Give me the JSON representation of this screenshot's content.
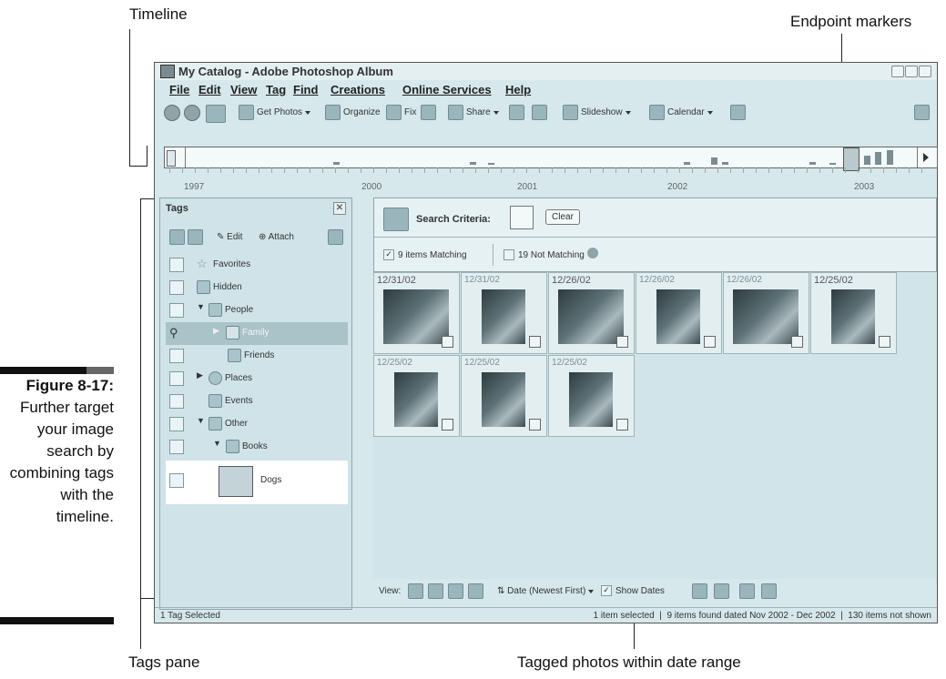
{
  "callouts": {
    "timeline": "Timeline",
    "endpoint_markers": "Endpoint markers",
    "tags_pane": "Tags pane",
    "tagged_photos": "Tagged photos within date range"
  },
  "caption": {
    "figure": "Figure 8-17:",
    "text": "Further target your image search by combining tags with the timeline."
  },
  "window": {
    "title": "My Catalog - Adobe Photoshop Album"
  },
  "menu": [
    "File",
    "Edit",
    "View",
    "Tag",
    "Find",
    "Creations",
    "Online Services",
    "Help"
  ],
  "toolbar": {
    "get_photos": "Get Photos",
    "organize": "Organize",
    "fix": "Fix",
    "share": "Share",
    "slideshow": "Slideshow",
    "calendar": "Calendar"
  },
  "timeline": {
    "years": [
      "1997",
      "2000",
      "2001",
      "2002",
      "2003"
    ]
  },
  "tags_pane": {
    "title": "Tags",
    "edit": "Edit",
    "attach": "Attach",
    "items": [
      "Favorites",
      "Hidden",
      "People",
      "Family",
      "Friends",
      "Places",
      "Events",
      "Other",
      "Books",
      "Dogs"
    ]
  },
  "search": {
    "criteria": "Search Criteria:",
    "clear": "Clear",
    "matching": "9 items Matching",
    "not_matching": "19 Not Matching"
  },
  "photos": {
    "dates": [
      "12/31/02",
      "12/31/02",
      "12/26/02",
      "12/26/02",
      "12/26/02",
      "12/25/02",
      "12/25/02",
      "12/25/02",
      "12/25/02"
    ]
  },
  "bottom": {
    "view": "View:",
    "sort": "Date (Newest First)",
    "show_dates": "Show Dates"
  },
  "status": {
    "left": "1 Tag Selected",
    "right": "1 item selected  |  9 items found dated Nov 2002 - Dec 2002  |  130 items not shown"
  }
}
